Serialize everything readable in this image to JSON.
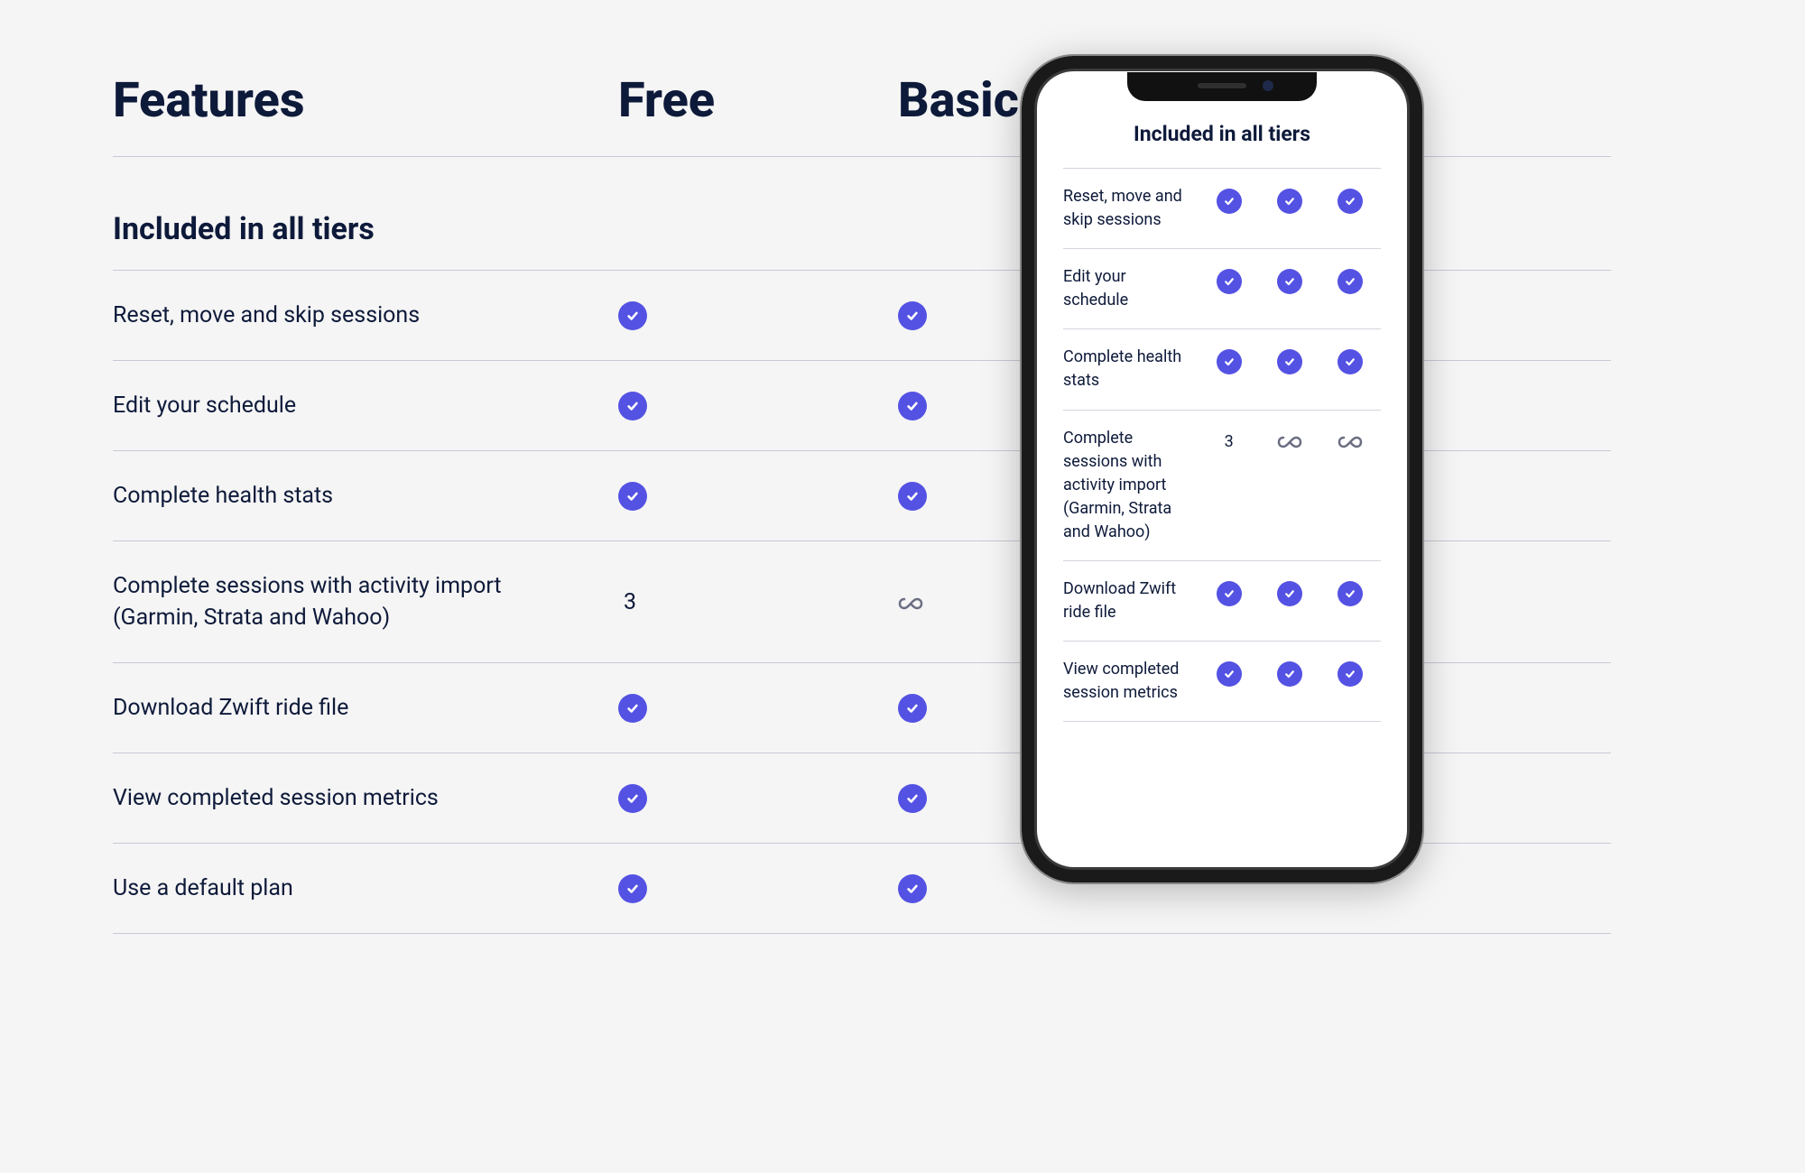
{
  "desktop": {
    "headers": {
      "features": "Features",
      "free": "Free",
      "basic": "Basic"
    },
    "section": "Included in all tiers",
    "rows": [
      {
        "label": "Reset, move and skip sessions",
        "free": "check",
        "basic": "check"
      },
      {
        "label": "Edit your schedule",
        "free": "check",
        "basic": "check"
      },
      {
        "label": "Complete health stats",
        "free": "check",
        "basic": "check"
      },
      {
        "label": "Complete sessions with activity import (Garmin, Strata and Wahoo)",
        "free": "3",
        "basic": "inf"
      },
      {
        "label": "Download Zwift ride file",
        "free": "check",
        "basic": "check"
      },
      {
        "label": "View completed session metrics",
        "free": "check",
        "basic": "check"
      },
      {
        "label": "Use a default plan",
        "free": "check",
        "basic": "check"
      }
    ]
  },
  "mobile": {
    "section": "Included in all tiers",
    "rows": [
      {
        "label": "Reset, move and skip sessions",
        "v": [
          "check",
          "check",
          "check"
        ]
      },
      {
        "label": "Edit your schedule",
        "v": [
          "check",
          "check",
          "check"
        ]
      },
      {
        "label": "Complete health stats",
        "v": [
          "check",
          "check",
          "check"
        ]
      },
      {
        "label": "Complete sessions with activity import (Garmin, Strata and Wahoo)",
        "v": [
          "3",
          "inf",
          "inf"
        ]
      },
      {
        "label": "Download Zwift ride file",
        "v": [
          "check",
          "check",
          "check"
        ]
      },
      {
        "label": "View completed session metrics",
        "v": [
          "check",
          "check",
          "check"
        ]
      }
    ]
  }
}
